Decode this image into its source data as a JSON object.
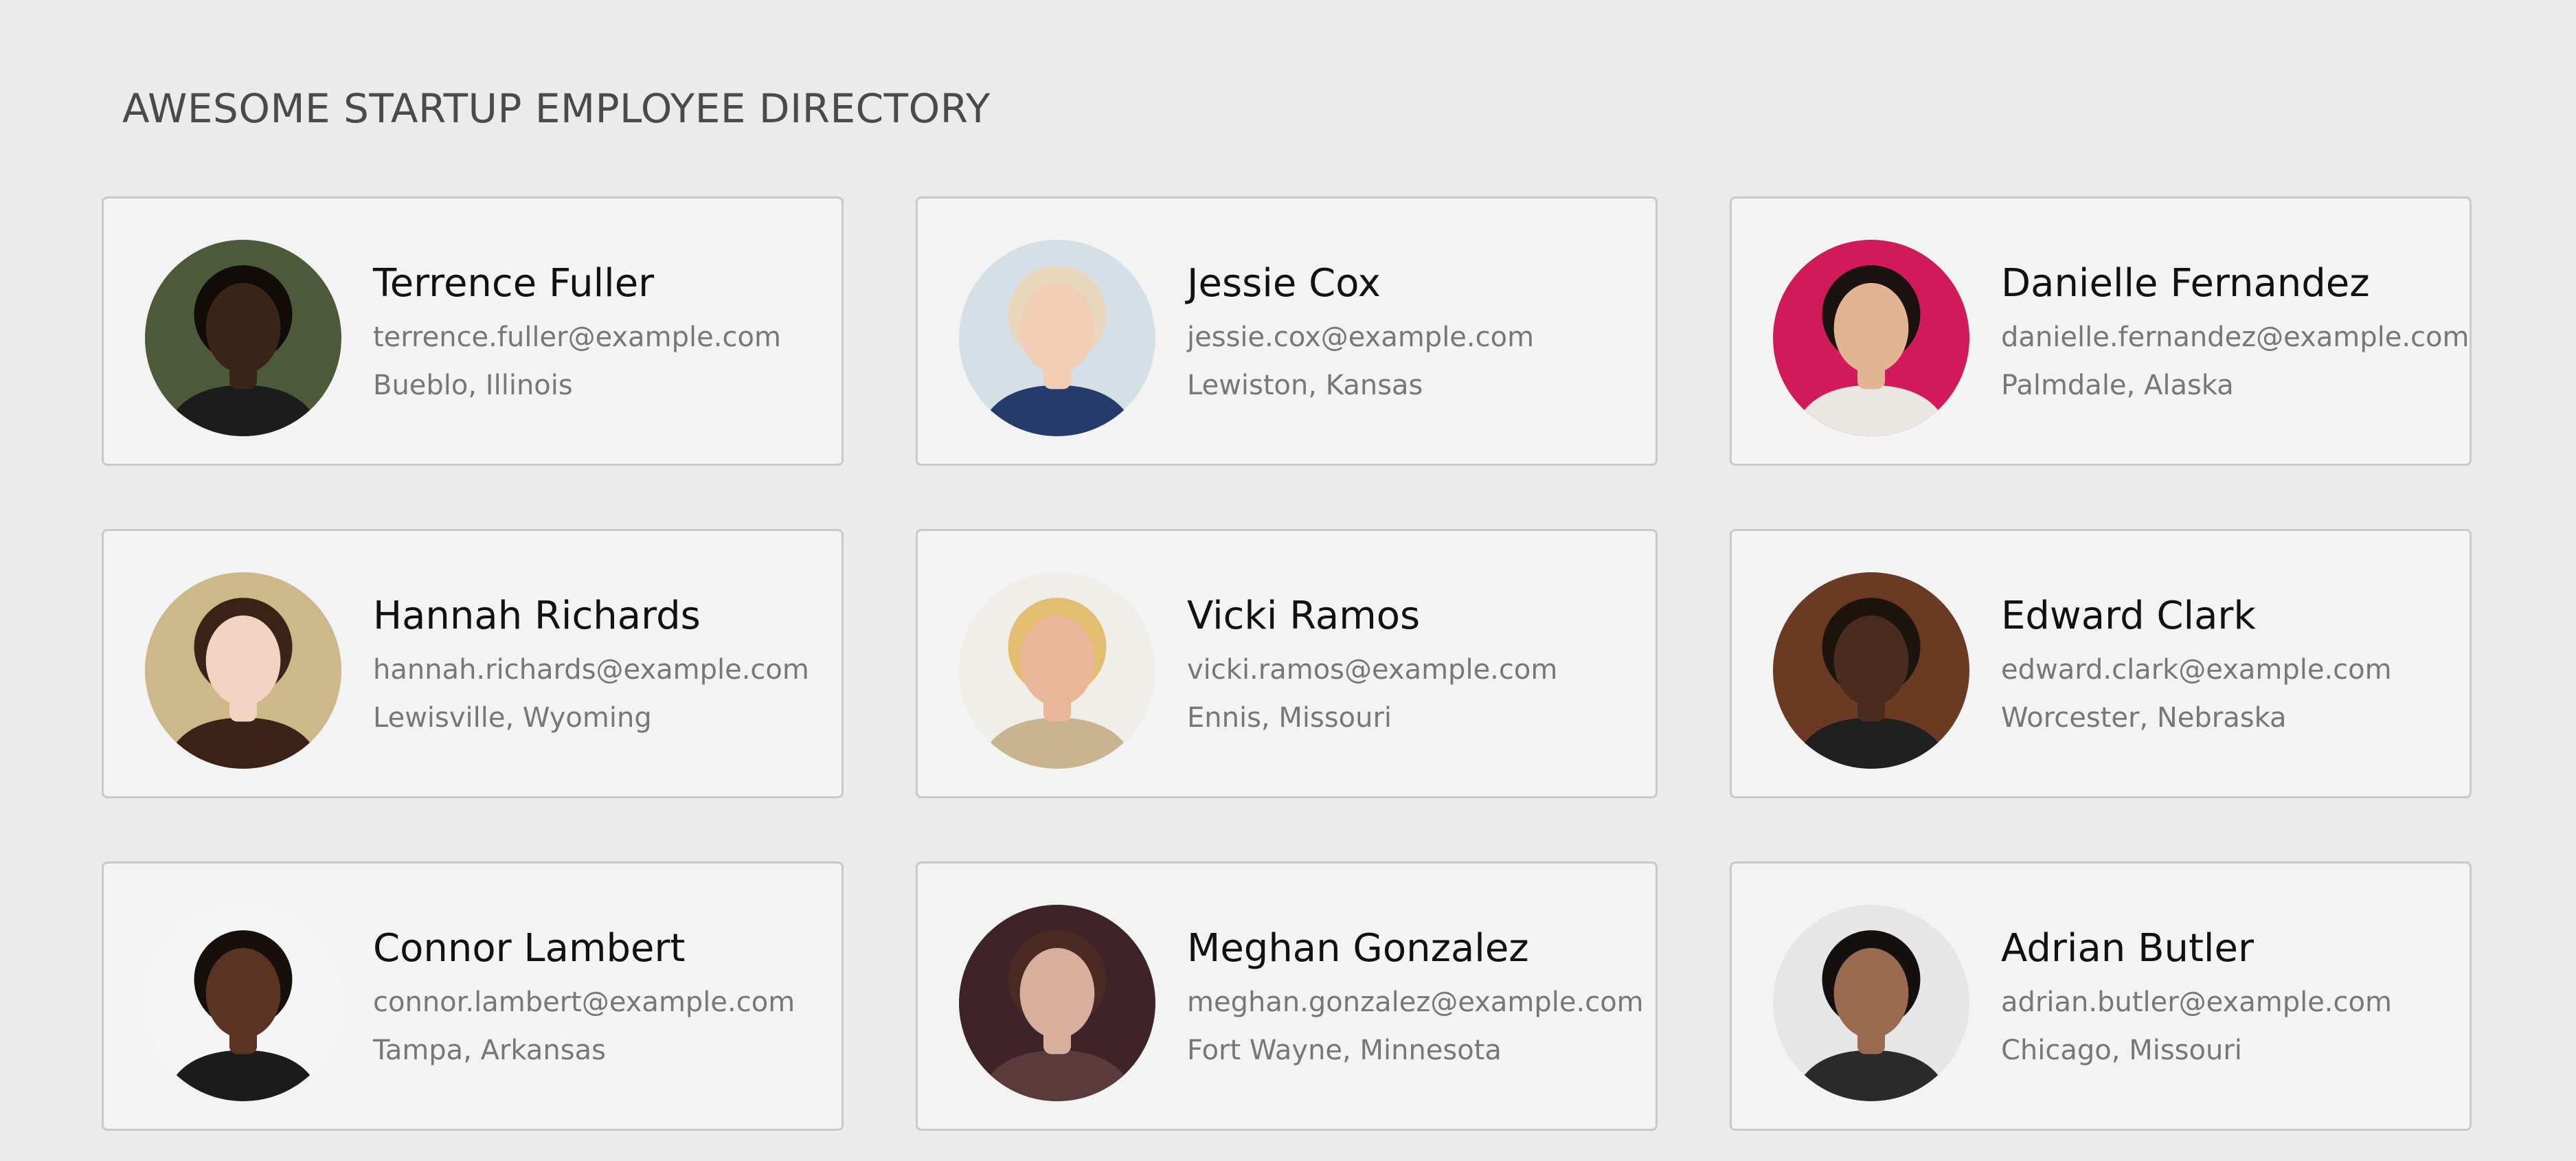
{
  "header": {
    "title": "AWESOME STARTUP EMPLOYEE DIRECTORY"
  },
  "employees": [
    {
      "name": "Terrence Fuller",
      "email": "terrence.fuller@example.com",
      "location": "Bueblo, Illinois",
      "avatar": {
        "bg": "#4d5a3a",
        "skin": "#3a2418",
        "hair": "#120c08",
        "shirt": "#1c1c1c"
      }
    },
    {
      "name": "Jessie Cox",
      "email": "jessie.cox@example.com",
      "location": "Lewiston, Kansas",
      "avatar": {
        "bg": "#d4e0e6",
        "skin": "#f0cdb4",
        "hair": "#e8d7bd",
        "shirt": "#243b6b"
      }
    },
    {
      "name": "Danielle Fernandez",
      "email": "danielle.fernandez@example.com",
      "location": "Palmdale, Alaska",
      "avatar": {
        "bg": "#d11a5a",
        "skin": "#e2b493",
        "hair": "#1a1210",
        "shirt": "#eae6e2"
      }
    },
    {
      "name": "Hannah Richards",
      "email": "hannah.richards@example.com",
      "location": "Lewisville, Wyoming",
      "avatar": {
        "bg": "#cdb88a",
        "skin": "#f2d2c0",
        "hair": "#3b2216",
        "shirt": "#3b2216"
      }
    },
    {
      "name": "Vicki Ramos",
      "email": "vicki.ramos@example.com",
      "location": "Ennis, Missouri",
      "avatar": {
        "bg": "#f0eee8",
        "skin": "#e9b798",
        "hair": "#e3bd70",
        "shirt": "#c8b48e"
      }
    },
    {
      "name": "Edward Clark",
      "email": "edward.clark@example.com",
      "location": "Worcester, Nebraska",
      "avatar": {
        "bg": "#6b3a22",
        "skin": "#4a2c1e",
        "hair": "#1e140e",
        "shirt": "#202020"
      }
    },
    {
      "name": "Connor Lambert",
      "email": "connor.lambert@example.com",
      "location": "Tampa, Arkansas",
      "avatar": {
        "bg": "#f5f5f5",
        "skin": "#5a3422",
        "hair": "#15100c",
        "shirt": "#1b1b1b"
      }
    },
    {
      "name": "Meghan Gonzalez",
      "email": "meghan.gonzalez@example.com",
      "location": "Fort Wayne, Minnesota",
      "avatar": {
        "bg": "#3e2428",
        "skin": "#d8ae9c",
        "hair": "#4a2a22",
        "shirt": "#5a3a3a"
      }
    },
    {
      "name": "Adrian Butler",
      "email": "adrian.butler@example.com",
      "location": "Chicago, Missouri",
      "avatar": {
        "bg": "#e6e6e6",
        "skin": "#9a6a4e",
        "hair": "#141010",
        "shirt": "#2a2a2a"
      }
    }
  ]
}
